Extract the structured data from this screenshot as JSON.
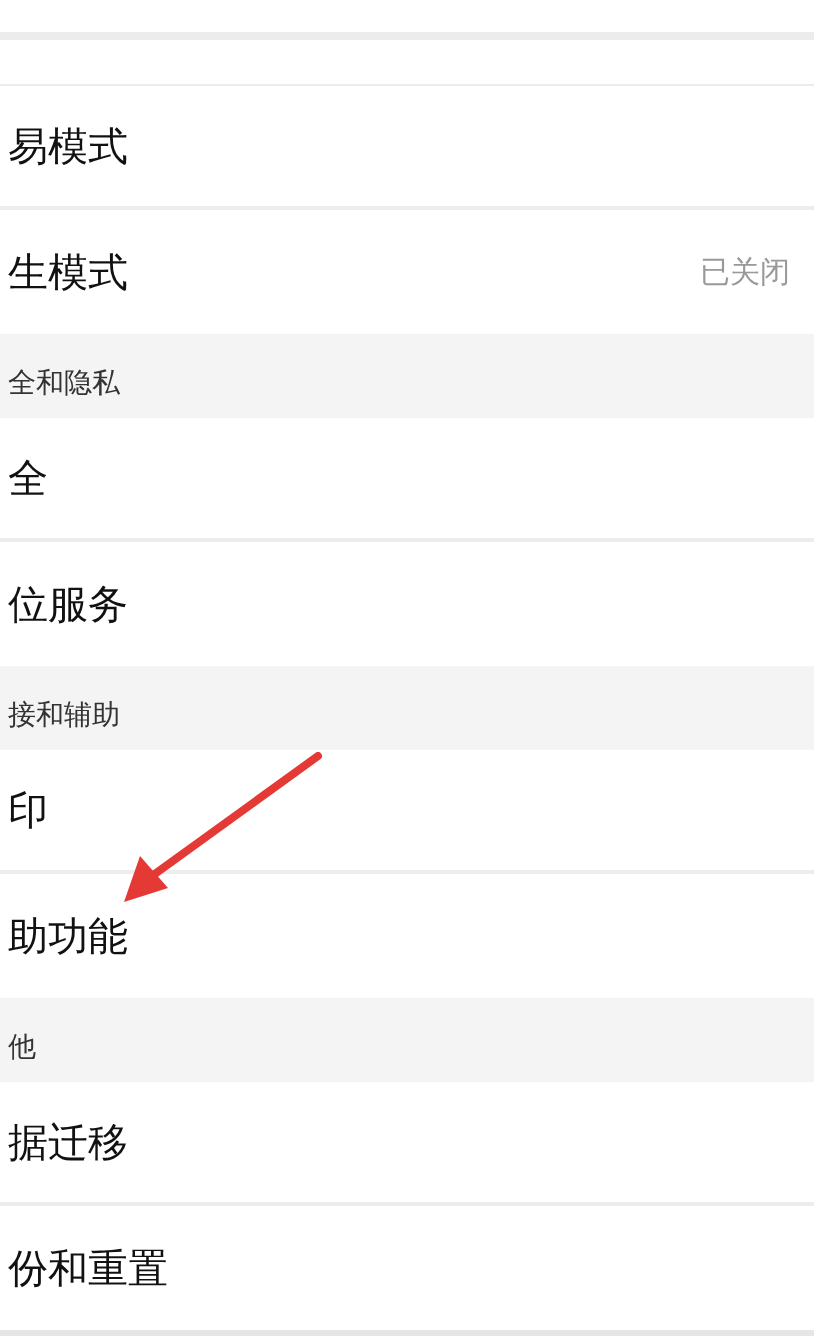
{
  "groups": [
    {
      "items": [
        {
          "label": "易模式"
        },
        {
          "label": "生模式",
          "value": "已关闭"
        }
      ]
    },
    {
      "header": "全和隐私",
      "items": [
        {
          "label": "全"
        },
        {
          "label": "位服务"
        }
      ]
    },
    {
      "header": "接和辅助",
      "items": [
        {
          "label": "印"
        },
        {
          "label": "助功能"
        }
      ]
    },
    {
      "header": "他",
      "items": [
        {
          "label": "据迁移"
        },
        {
          "label": "份和重置"
        }
      ]
    }
  ]
}
